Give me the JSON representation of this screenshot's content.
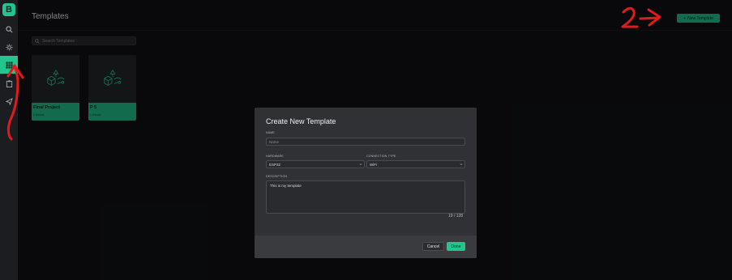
{
  "sidebar": {
    "logo": "B",
    "items": [
      {
        "icon": "search-icon"
      },
      {
        "icon": "sun-icon"
      },
      {
        "icon": "grid-icon",
        "active": true
      },
      {
        "icon": "clipboard-icon"
      },
      {
        "icon": "send-icon"
      }
    ]
  },
  "header": {
    "title": "Templates",
    "new_button": "New Template"
  },
  "search": {
    "placeholder": "Search Templates"
  },
  "templates": [
    {
      "name": "Final Project",
      "devices": "1 Device"
    },
    {
      "name": "P 5",
      "devices": "1 Device"
    }
  ],
  "modal": {
    "title": "Create New Template",
    "name_label": "NAME",
    "name_placeholder": "Name",
    "hardware_label": "HARDWARE",
    "hardware_value": "ESP32",
    "connection_label": "CONNECTION TYPE",
    "connection_value": "WiFi",
    "description_label": "DESCRIPTION",
    "description_value": "This is my template",
    "counter": "19 / 128",
    "cancel": "Cancel",
    "done": "Done"
  },
  "colors": {
    "accent": "#23c48e",
    "annotation": "#e01b1b"
  }
}
